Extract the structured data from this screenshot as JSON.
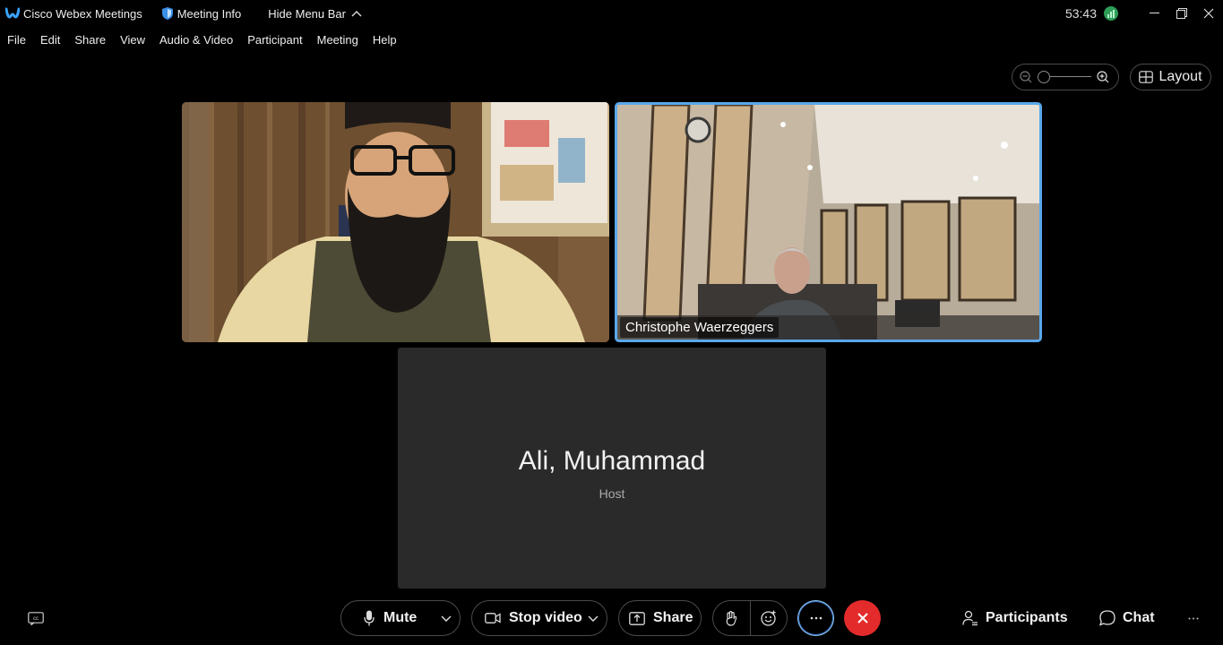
{
  "titlebar": {
    "app_title": "Cisco Webex Meetings",
    "meeting_info_label": "Meeting Info",
    "hide_menu_label": "Hide Menu Bar",
    "timer": "53:43"
  },
  "menubar": {
    "items": [
      "File",
      "Edit",
      "Share",
      "View",
      "Audio & Video",
      "Participant",
      "Meeting",
      "Help"
    ]
  },
  "view_controls": {
    "layout_label": "Layout"
  },
  "video_tiles": [
    {
      "name": ""
    },
    {
      "name": "Christophe Waerzeggers"
    }
  ],
  "placeholder_tile": {
    "name": "Ali, Muhammad",
    "role": "Host"
  },
  "controls": {
    "mute_label": "Mute",
    "video_label": "Stop video",
    "share_label": "Share",
    "participants_label": "Participants",
    "chat_label": "Chat"
  },
  "colors": {
    "accent_blue": "#5aa7ea",
    "end_red": "#e32b2b",
    "network_green": "#2e9d57",
    "tile_gray": "#2a2a2a"
  },
  "icons": [
    "webex-logo-icon",
    "shield-icon",
    "chevron-up-icon",
    "network-quality-icon",
    "minimize-icon",
    "restore-icon",
    "close-icon",
    "zoom-out-icon",
    "zoom-in-icon",
    "layout-grid-icon",
    "closed-captions-icon",
    "microphone-icon",
    "video-camera-icon",
    "share-screen-icon",
    "raise-hand-icon",
    "reactions-icon",
    "more-options-icon",
    "end-meeting-icon",
    "participants-icon",
    "chat-icon",
    "overflow-icon"
  ]
}
